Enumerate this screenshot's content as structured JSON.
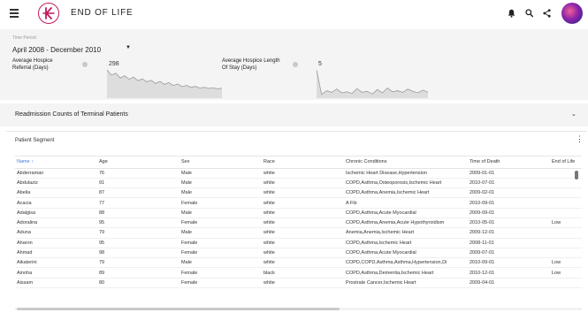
{
  "header": {
    "title": "END OF LIFE",
    "icons": [
      "menu-icon",
      "logo-icon",
      "bell-icon",
      "search-icon",
      "share-icon",
      "avatar"
    ]
  },
  "filters": {
    "period_label": "Time Period",
    "period_value": "April 2008 - December 2010",
    "period_caret": "▼"
  },
  "metrics": [
    {
      "label_line1": "Average Hospice",
      "label_line2": "Referral (Days)",
      "value": "298"
    },
    {
      "label_line1": "Average Hospice Length",
      "label_line2": "Of Stay (Days)",
      "value": "5"
    }
  ],
  "sparklines": {
    "referral": [
      298,
      240,
      262,
      210,
      235,
      195,
      220,
      180,
      200,
      168,
      185,
      150,
      172,
      140,
      160,
      128,
      145,
      115,
      130,
      108,
      118,
      100,
      108,
      96,
      102,
      92,
      98
    ],
    "length_of_stay": [
      5,
      0.5,
      1.2,
      0.9,
      1.5,
      0.8,
      1.0,
      0.7,
      1.6,
      0.9,
      1.1,
      0.6,
      1.4,
      0.8,
      1.7,
      1.0,
      1.2,
      0.9,
      1.5,
      1.1,
      0.8,
      1.3,
      0.9
    ]
  },
  "colors": {
    "accent": "#c2185b",
    "sort_header": "#3f7de0",
    "spark_fill": "#dddddd",
    "spark_line": "#9a9a9a"
  },
  "readmission": {
    "title": "Readmission Counts of Terminal Patients",
    "chevron": "⌄"
  },
  "segment": {
    "title": "Patient Segment",
    "menu": "⋮",
    "columns": [
      "Name ↑",
      "Age",
      "Sex",
      "Race",
      "Chronic Conditions",
      "Time of Death",
      "End of Life"
    ],
    "rows": [
      [
        "Abderraman",
        "76",
        "Male",
        "white",
        "Ischemic Heart Disease,Hypertension",
        "2009-01-01",
        ""
      ],
      [
        "Abdulaziz",
        "91",
        "Male",
        "white",
        "COPD,Asthma,Osteoporosis,Ischemic Heart",
        "2010-07-01",
        ""
      ],
      [
        "Abelia",
        "87",
        "Male",
        "white",
        "COPD,Asthma,Anemia,Ischemic Heart",
        "2009-02-01",
        ""
      ],
      [
        "Acacia",
        "77",
        "Female",
        "white",
        "A Fib",
        "2010-09-01",
        ""
      ],
      [
        "Adalgisa",
        "88",
        "Male",
        "white",
        "COPD,Asthma,Acute Myocardial",
        "2009-09-01",
        ""
      ],
      [
        "Adoralina",
        "95",
        "Female",
        "white",
        "COPD,Asthma,Anemia,Acute Hypothyroidism",
        "2010-05-01",
        "Low"
      ],
      [
        "Aduna",
        "79",
        "Male",
        "white",
        "Anemia,Anemia,Ischemic Heart",
        "2009-12-01",
        ""
      ],
      [
        "Aharon",
        "95",
        "Female",
        "white",
        "COPD,Asthma,Ischemic Heart",
        "2008-11-01",
        ""
      ],
      [
        "Ahmad",
        "98",
        "Female",
        "white",
        "COPD,Asthma,Acute Myocardial",
        "2009-07-01",
        ""
      ],
      [
        "Aikaterini",
        "79",
        "Male",
        "white",
        "COPD,COPD,Asthma,Asthma,Hypertension,Di",
        "2010-09-01",
        "Low"
      ],
      [
        "Ainoha",
        "89",
        "Female",
        "black",
        "COPD,Asthma,Dementia,Ischemic Heart",
        "2010-12-01",
        "Low"
      ],
      [
        "Aissam",
        "80",
        "Female",
        "white",
        "Prostrate Cancer,Ischemic Heart",
        "2009-04-01",
        ""
      ]
    ]
  }
}
